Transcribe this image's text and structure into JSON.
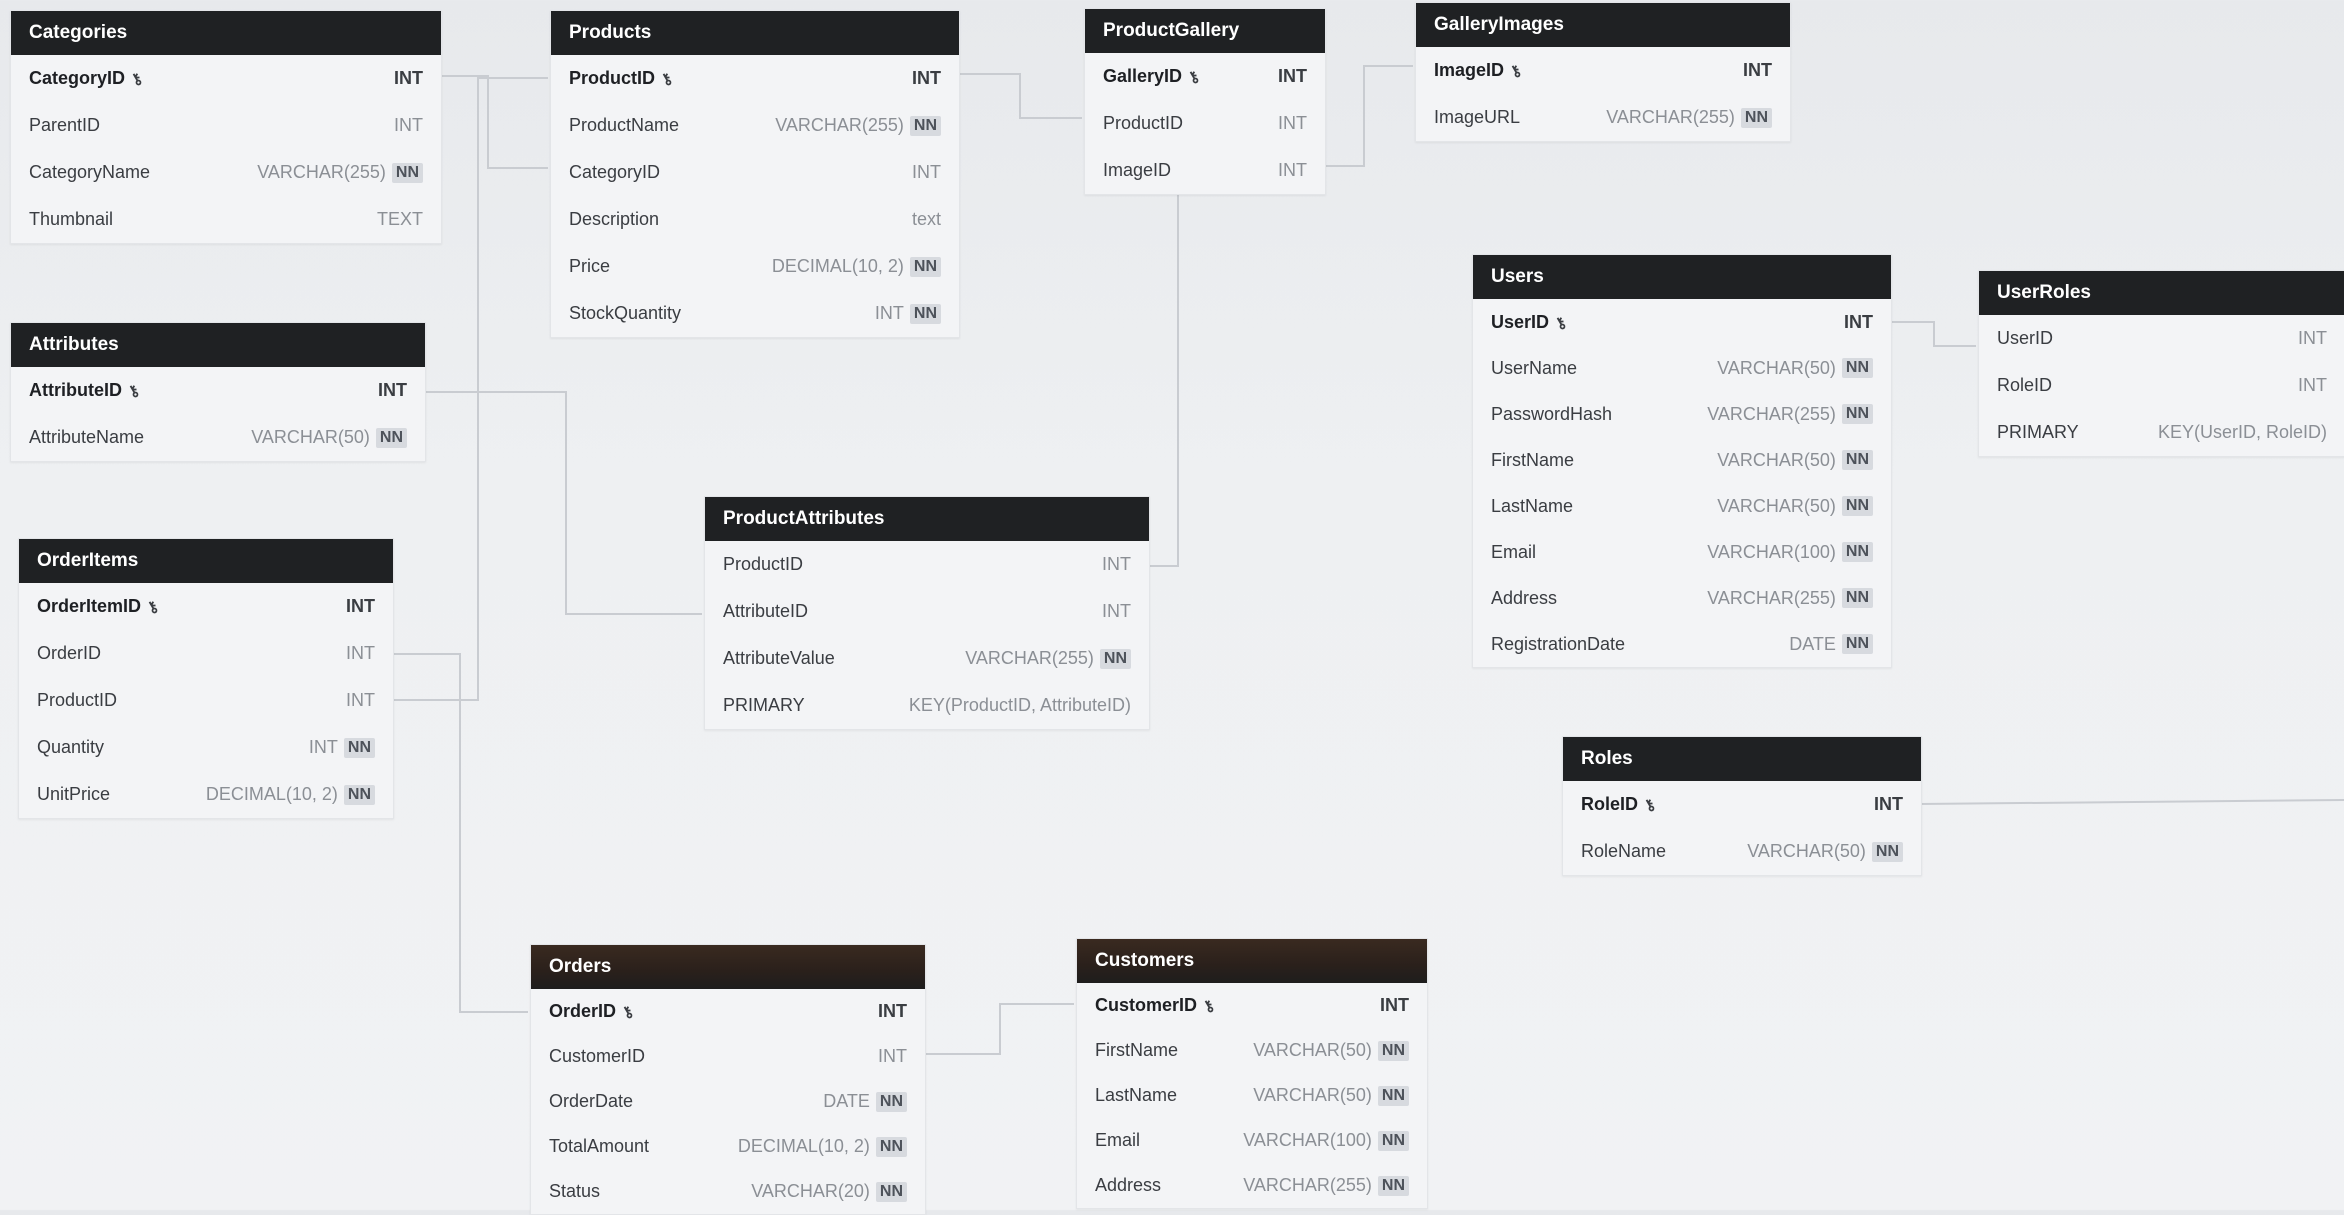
{
  "tables": {
    "categories": {
      "title": "Categories",
      "rows": [
        {
          "name": "CategoryID",
          "type": "INT"
        },
        {
          "name": "ParentID",
          "type": "INT"
        },
        {
          "name": "CategoryName",
          "type": "VARCHAR(255)",
          "nn": "NN"
        },
        {
          "name": "Thumbnail",
          "type": "TEXT"
        }
      ]
    },
    "products": {
      "title": "Products",
      "rows": [
        {
          "name": "ProductID",
          "type": "INT"
        },
        {
          "name": "ProductName",
          "type": "VARCHAR(255)",
          "nn": "NN"
        },
        {
          "name": "CategoryID",
          "type": "INT"
        },
        {
          "name": "Description",
          "type": "text"
        },
        {
          "name": "Price",
          "type": "DECIMAL(10, 2)",
          "nn": "NN"
        },
        {
          "name": "StockQuantity",
          "type": "INT",
          "nn": "NN"
        }
      ]
    },
    "productgallery": {
      "title": "ProductGallery",
      "rows": [
        {
          "name": "GalleryID",
          "type": "INT"
        },
        {
          "name": "ProductID",
          "type": "INT"
        },
        {
          "name": "ImageID",
          "type": "INT"
        }
      ]
    },
    "galleryimages": {
      "title": "GalleryImages",
      "rows": [
        {
          "name": "ImageID",
          "type": "INT"
        },
        {
          "name": "ImageURL",
          "type": "VARCHAR(255)",
          "nn": "NN"
        }
      ]
    },
    "attributes": {
      "title": "Attributes",
      "rows": [
        {
          "name": "AttributeID",
          "type": "INT"
        },
        {
          "name": "AttributeName",
          "type": "VARCHAR(50)",
          "nn": "NN"
        }
      ]
    },
    "orderitems": {
      "title": "OrderItems",
      "rows": [
        {
          "name": "OrderItemID",
          "type": "INT"
        },
        {
          "name": "OrderID",
          "type": "INT"
        },
        {
          "name": "ProductID",
          "type": "INT"
        },
        {
          "name": "Quantity",
          "type": "INT",
          "nn": "NN"
        },
        {
          "name": "UnitPrice",
          "type": "DECIMAL(10, 2)",
          "nn": "NN"
        }
      ]
    },
    "productattributes": {
      "title": "ProductAttributes",
      "rows": [
        {
          "name": "ProductID",
          "type": "INT"
        },
        {
          "name": "AttributeID",
          "type": "INT"
        },
        {
          "name": "AttributeValue",
          "type": "VARCHAR(255)",
          "nn": "NN"
        },
        {
          "name": "PRIMARY",
          "type": "KEY(ProductID, AttributeID)"
        }
      ]
    },
    "users": {
      "title": "Users",
      "rows": [
        {
          "name": "UserID",
          "type": "INT"
        },
        {
          "name": "UserName",
          "type": "VARCHAR(50)",
          "nn": "NN"
        },
        {
          "name": "PasswordHash",
          "type": "VARCHAR(255)",
          "nn": "NN"
        },
        {
          "name": "FirstName",
          "type": "VARCHAR(50)",
          "nn": "NN"
        },
        {
          "name": "LastName",
          "type": "VARCHAR(50)",
          "nn": "NN"
        },
        {
          "name": "Email",
          "type": "VARCHAR(100)",
          "nn": "NN"
        },
        {
          "name": "Address",
          "type": "VARCHAR(255)",
          "nn": "NN"
        },
        {
          "name": "RegistrationDate",
          "type": "DATE",
          "nn": "NN"
        }
      ]
    },
    "userroles": {
      "title": "UserRoles",
      "rows": [
        {
          "name": "UserID",
          "type": "INT"
        },
        {
          "name": "RoleID",
          "type": "INT"
        },
        {
          "name": "PRIMARY",
          "type": "KEY(UserID, RoleID)"
        }
      ]
    },
    "roles": {
      "title": "Roles",
      "rows": [
        {
          "name": "RoleID",
          "type": "INT"
        },
        {
          "name": "RoleName",
          "type": "VARCHAR(50)",
          "nn": "NN"
        }
      ]
    },
    "orders": {
      "title": "Orders",
      "rows": [
        {
          "name": "OrderID",
          "type": "INT"
        },
        {
          "name": "CustomerID",
          "type": "INT"
        },
        {
          "name": "OrderDate",
          "type": "DATE",
          "nn": "NN"
        },
        {
          "name": "TotalAmount",
          "type": "DECIMAL(10, 2)",
          "nn": "NN"
        },
        {
          "name": "Status",
          "type": "VARCHAR(20)",
          "nn": "NN"
        }
      ]
    },
    "customers": {
      "title": "Customers",
      "rows": [
        {
          "name": "CustomerID",
          "type": "INT"
        },
        {
          "name": "FirstName",
          "type": "VARCHAR(50)",
          "nn": "NN"
        },
        {
          "name": "LastName",
          "type": "VARCHAR(50)",
          "nn": "NN"
        },
        {
          "name": "Email",
          "type": "VARCHAR(100)",
          "nn": "NN"
        },
        {
          "name": "Address",
          "type": "VARCHAR(255)",
          "nn": "NN"
        }
      ]
    }
  },
  "colors": {
    "header_bg": "#1f2123",
    "header_text": "#ffffff",
    "table_bg": "#f3f4f6",
    "nn_badge": "#d7dadf",
    "connector": "#c9ccd1"
  },
  "icons": {
    "primary_key": "key-icon"
  }
}
